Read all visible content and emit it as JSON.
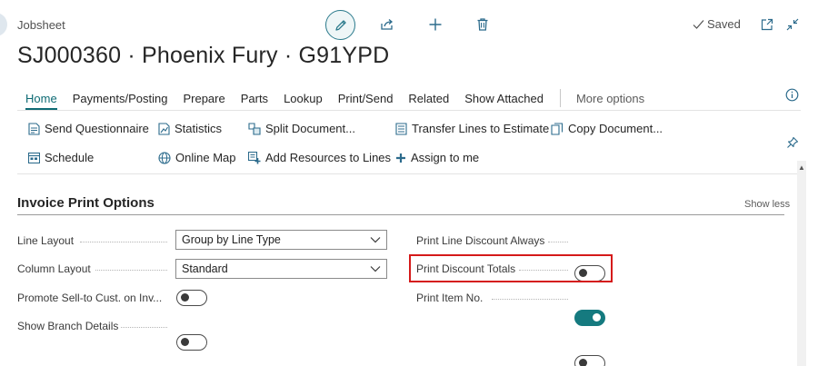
{
  "header": {
    "breadcrumb": "Jobsheet",
    "title": "SJ000360 · Phoenix Fury · G91YPD",
    "status": "Saved",
    "icons": [
      "edit-icon",
      "share-icon",
      "add-icon",
      "delete-icon",
      "open-new-window-icon",
      "collapse-icon"
    ]
  },
  "tabs": {
    "items": [
      "Home",
      "Payments/Posting",
      "Prepare",
      "Parts",
      "Lookup",
      "Print/Send",
      "Related",
      "Show Attached"
    ],
    "active": "Home",
    "more": "More options"
  },
  "actions": {
    "row1": [
      "Send Questionnaire",
      "Statistics",
      "Split Document...",
      "Transfer Lines to Estimate",
      "Copy Document..."
    ],
    "row2": [
      "Schedule",
      "Online Map",
      "Add Resources to Lines",
      "Assign to me"
    ]
  },
  "section": {
    "title": "Invoice Print Options",
    "toggle_label": "Show less"
  },
  "fields": {
    "line_layout": {
      "label": "Line Layout",
      "value": "Group by Line Type"
    },
    "column_layout": {
      "label": "Column Layout",
      "value": "Standard"
    },
    "promote_sell_to": {
      "label": "Promote Sell-to Cust. on Inv...",
      "value": false
    },
    "show_branch_details": {
      "label": "Show Branch Details",
      "value": false
    },
    "print_line_discount_always": {
      "label": "Print Line Discount Always",
      "value": false
    },
    "print_discount_totals": {
      "label": "Print Discount Totals",
      "value": true
    },
    "print_item_no": {
      "label": "Print Item No.",
      "value": false
    }
  },
  "colors": {
    "accent": "#0e6b74",
    "toggle_on": "#157a7f",
    "highlight": "#d51a1a"
  }
}
